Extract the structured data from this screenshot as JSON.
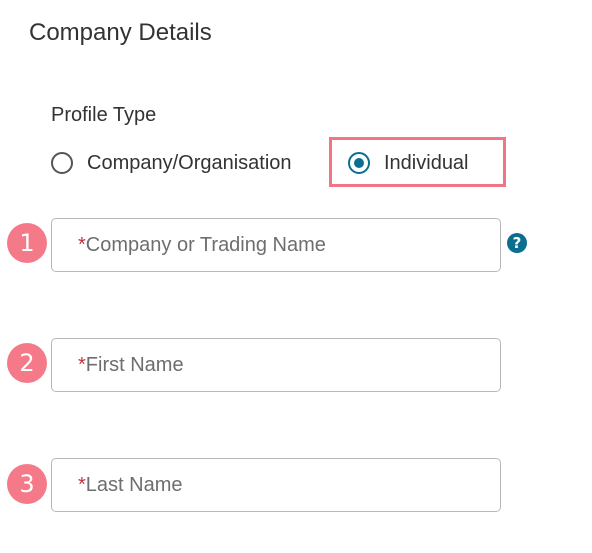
{
  "section": {
    "title": "Company Details"
  },
  "profile_type": {
    "label": "Profile Type",
    "options": [
      {
        "label": "Company/Organisation",
        "selected": false
      },
      {
        "label": "Individual",
        "selected": true
      }
    ]
  },
  "fields": [
    {
      "step": "1",
      "required_mark": "*",
      "placeholder": "Company or Trading Name"
    },
    {
      "step": "2",
      "required_mark": "*",
      "placeholder": "First Name"
    },
    {
      "step": "3",
      "required_mark": "*",
      "placeholder": "Last Name"
    }
  ],
  "help": {
    "glyph": "?",
    "icon": "question-circle-icon"
  },
  "colors": {
    "accent": "#0a6f8f",
    "highlight": "#f07686",
    "badge": "#f47a8a",
    "required": "#c0313d"
  }
}
